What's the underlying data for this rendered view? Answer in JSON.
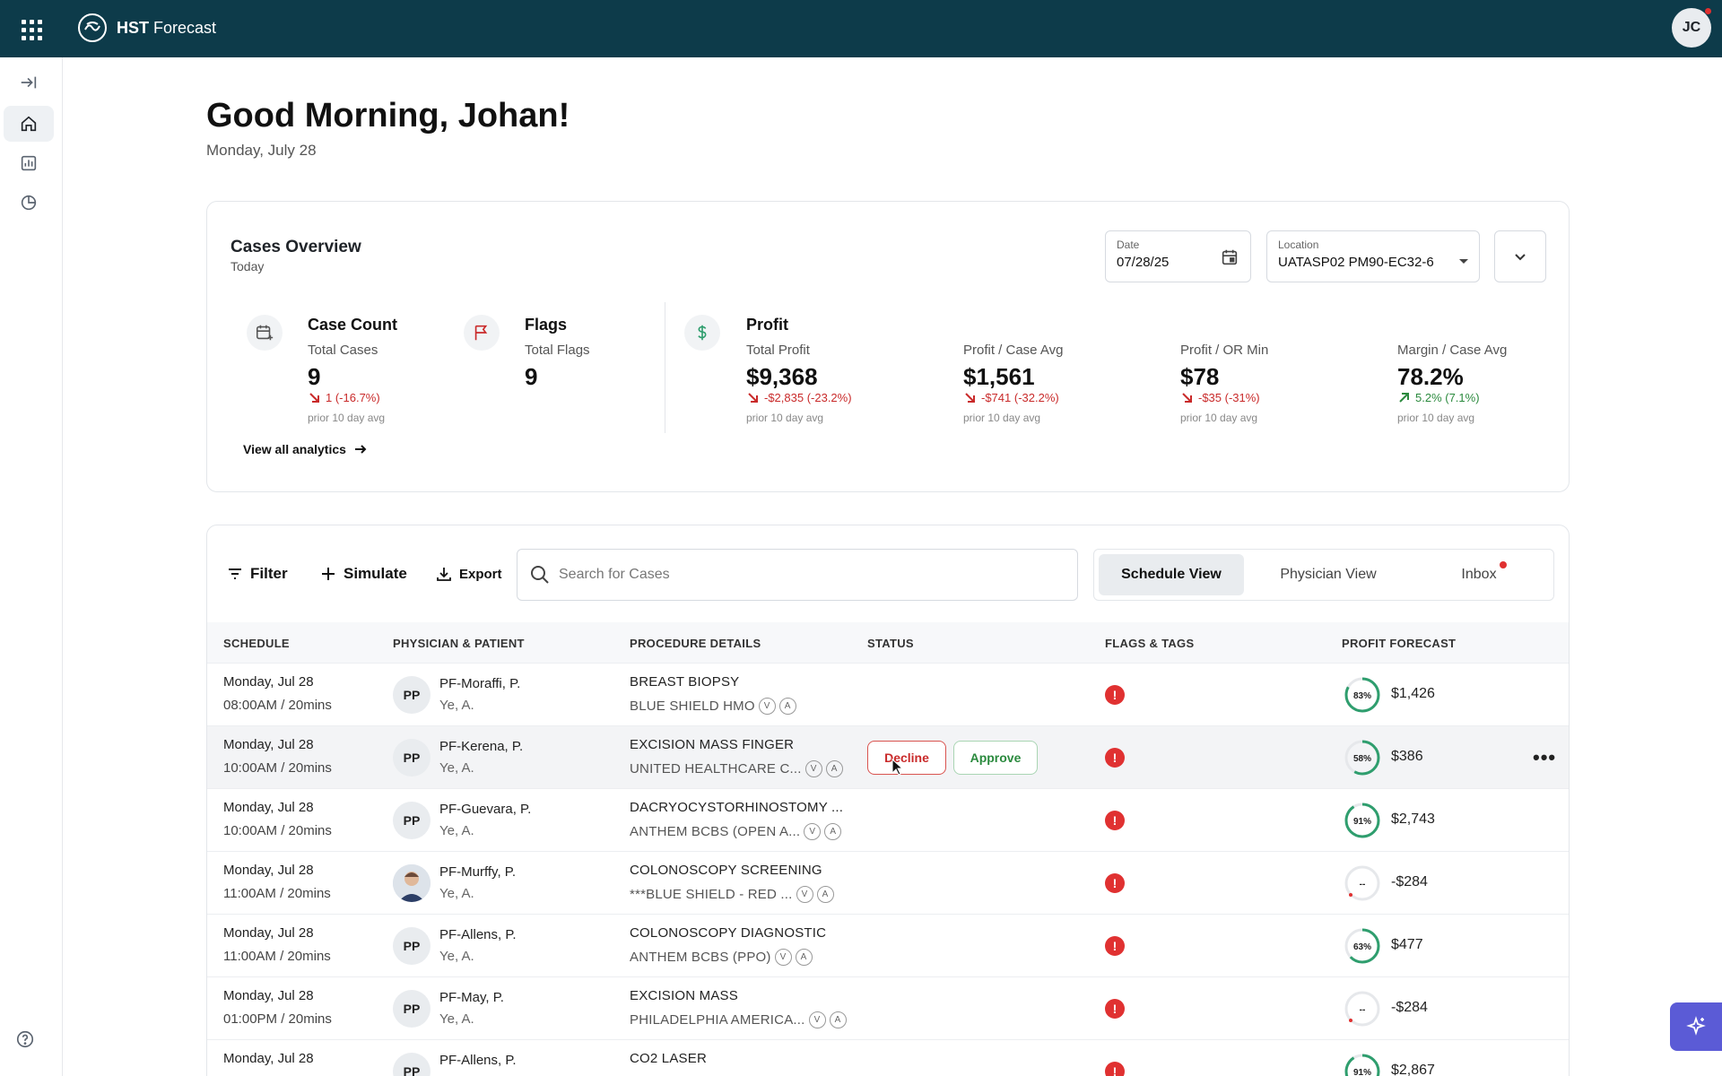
{
  "app": {
    "brand_bold": "HST",
    "brand_rest": " Forecast",
    "user_initials": "JC"
  },
  "greeting": {
    "title": "Good Morning, Johan!",
    "date": "Monday, July 28"
  },
  "overview": {
    "title": "Cases Overview",
    "subtitle": "Today",
    "date_label": "Date",
    "date_value": "07/28/25",
    "location_label": "Location",
    "location_value": "UATASP02 PM90-EC32-6",
    "metrics": {
      "case_count": {
        "head": "Case Count",
        "label": "Total Cases",
        "value": "9",
        "delta": "1 (-16.7%)",
        "note": "prior 10 day avg"
      },
      "flags": {
        "head": "Flags",
        "label": "Total Flags",
        "value": "9"
      },
      "profit": {
        "head": "Profit",
        "label": "Total Profit",
        "value": "$9,368",
        "delta": "-$2,835 (-23.2%)",
        "note": "prior 10 day avg"
      },
      "profit_case": {
        "label": "Profit / Case Avg",
        "value": "$1,561",
        "delta": "-$741 (-32.2%)",
        "note": "prior 10 day avg"
      },
      "profit_or": {
        "label": "Profit / OR Min",
        "value": "$78",
        "delta": "-$35 (-31%)",
        "note": "prior 10 day avg"
      },
      "margin": {
        "label": "Margin / Case Avg",
        "value": "78.2%",
        "delta": "5.2% (7.1%)",
        "note": "prior 10 day avg"
      }
    },
    "view_all": "View all analytics"
  },
  "toolbar": {
    "filter": "Filter",
    "simulate": "Simulate",
    "export": "Export",
    "search_placeholder": "Search for Cases",
    "views": [
      "Schedule View",
      "Physician View",
      "Inbox"
    ]
  },
  "table": {
    "headers": [
      "SCHEDULE",
      "PHYSICIAN & PATIENT",
      "PROCEDURE DETAILS",
      "STATUS",
      "FLAGS & TAGS",
      "PROFIT FORECAST"
    ],
    "rows": [
      {
        "date": "Monday, Jul 28",
        "time": "08:00AM / 20mins",
        "initials": "PP",
        "physician": "PF-Moraffi, P.",
        "patient": "Ye, A.",
        "procedure": "BREAST BIOPSY",
        "insurance": "BLUE SHIELD HMO",
        "gauge": "83%",
        "profit": "$1,426"
      },
      {
        "date": "Monday, Jul 28",
        "time": "10:00AM / 20mins",
        "initials": "PP",
        "physician": "PF-Kerena, P.",
        "patient": "Ye, A.",
        "procedure": "EXCISION MASS FINGER",
        "insurance": "UNITED HEALTHCARE C...",
        "gauge": "58%",
        "profit": "$386",
        "decline": "Decline",
        "approve": "Approve",
        "more": "•••"
      },
      {
        "date": "Monday, Jul 28",
        "time": "10:00AM / 20mins",
        "initials": "PP",
        "physician": "PF-Guevara, P.",
        "patient": "Ye, A.",
        "procedure": "DACRYOCYSTORHINOSTOMY ...",
        "insurance": "ANTHEM BCBS (OPEN A...",
        "gauge": "91%",
        "profit": "$2,743"
      },
      {
        "date": "Monday, Jul 28",
        "time": "11:00AM / 20mins",
        "initials": "",
        "physician": "PF-Murffy, P.",
        "patient": "Ye, A.",
        "procedure": "COLONOSCOPY SCREENING",
        "insurance": "***BLUE SHIELD - RED ...",
        "gauge": "--",
        "profit": "-$284"
      },
      {
        "date": "Monday, Jul 28",
        "time": "11:00AM / 20mins",
        "initials": "PP",
        "physician": "PF-Allens, P.",
        "patient": "Ye, A.",
        "procedure": "COLONOSCOPY DIAGNOSTIC",
        "insurance": "ANTHEM BCBS (PPO)",
        "gauge": "63%",
        "profit": "$477"
      },
      {
        "date": "Monday, Jul 28",
        "time": "01:00PM / 20mins",
        "initials": "PP",
        "physician": "PF-May, P.",
        "patient": "Ye, A.",
        "procedure": "EXCISION MASS",
        "insurance": "PHILADELPHIA AMERICA...",
        "gauge": "--",
        "profit": "-$284"
      },
      {
        "date": "Monday, Jul 28",
        "time": "",
        "initials": "PP",
        "physician": "PF-Allens, P.",
        "patient": "",
        "procedure": "CO2 LASER",
        "insurance": "",
        "gauge": "91%",
        "profit": "$2,867"
      }
    ],
    "badge_v": "V",
    "badge_a": "A",
    "flag_glyph": "!"
  },
  "colors": {
    "topbar": "#0d3b4a",
    "flag": "#e03131",
    "gauge_green": "#2f9e6e",
    "accent": "#5b5bd6"
  }
}
